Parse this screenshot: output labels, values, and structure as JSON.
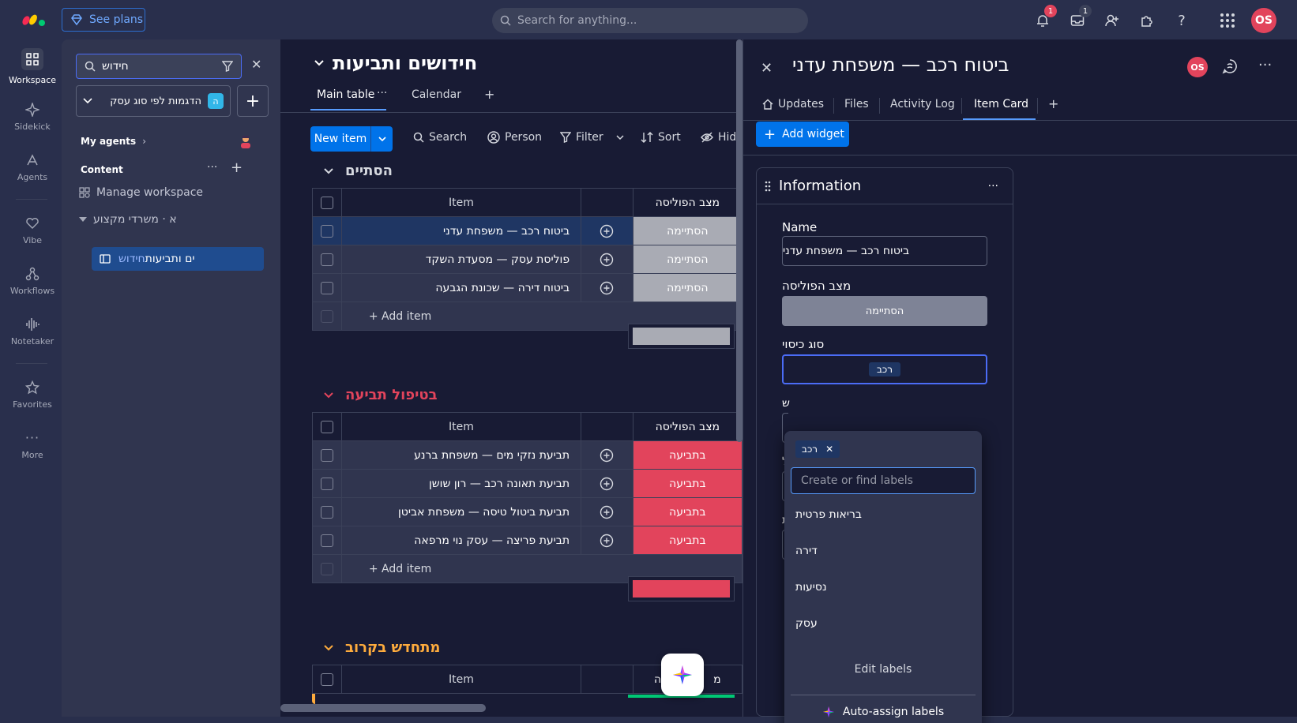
{
  "topbar": {
    "see_plans": "See plans",
    "search_placeholder": "Search for anything...",
    "notifications_count": "1",
    "inbox_count": "1",
    "avatar_initials": "OS"
  },
  "rail": {
    "items": [
      {
        "label": "Workspace",
        "icon": "grid-icon"
      },
      {
        "label": "Sidekick",
        "icon": "sparkle-icon"
      },
      {
        "label": "Agents",
        "icon": "agent-icon"
      },
      {
        "label": "Vibe",
        "icon": "heart-icon"
      },
      {
        "label": "Workflows",
        "icon": "workflow-icon"
      },
      {
        "label": "Notetaker",
        "icon": "waveform-icon"
      },
      {
        "label": "Favorites",
        "icon": "star-icon"
      },
      {
        "label": "More",
        "icon": "more-icon"
      }
    ]
  },
  "workspace": {
    "search_value": "חידוש",
    "workspace_select": "הדגמות לפי סוג עסק",
    "workspace_badge": "ה",
    "my_agents": "My agents",
    "content": "Content",
    "manage": "Manage workspace",
    "folder": "א · משרדי מקצוע",
    "board_highlight": "חידוש",
    "board_rest": "ים ותביעות"
  },
  "board": {
    "title": "חידושים ותביעות",
    "tabs": {
      "main": "Main table",
      "calendar": "Calendar"
    },
    "toolbar": {
      "new_item": "New item",
      "search": "Search",
      "person": "Person",
      "filter": "Filter",
      "sort": "Sort",
      "hide": "Hid"
    },
    "columns": {
      "item": "Item",
      "status": "מצב הפוליסה"
    },
    "add_item": "+ Add item",
    "groups": [
      {
        "title": "הסתיים",
        "color": "#c4c4c4",
        "rows": [
          {
            "item": "ביטוח רכב — משפחת עדני",
            "status": "הסתיימה",
            "status_color": "#a9abb4",
            "selected": true
          },
          {
            "item": "פוליסת עסק — מסעדת השקד",
            "status": "הסתיימה",
            "status_color": "#a9abb4",
            "selected": false
          },
          {
            "item": "ביטוח דירה — שכונת הגבעה",
            "status": "הסתיימה",
            "status_color": "#a9abb4",
            "selected": false
          }
        ]
      },
      {
        "title": "בטיפול תביעה",
        "color": "#e2445c",
        "rows": [
          {
            "item": "תביעת נזקי מים — משפחת ברנע",
            "status": "בתביעה",
            "status_color": "#e2445c",
            "selected": false
          },
          {
            "item": "תביעת תאונה רכב — רון שושן",
            "status": "בתביעה",
            "status_color": "#e2445c",
            "selected": false
          },
          {
            "item": "תביעת ביטול טיסה — משפחת אביטן",
            "status": "בתביעה",
            "status_color": "#e2445c",
            "selected": false
          },
          {
            "item": "תביעת פריצה — עסק נוי מרפאה",
            "status": "בתביעה",
            "status_color": "#e2445c",
            "selected": false
          }
        ]
      },
      {
        "title": "מתחדש בקרוב",
        "color": "#fdab3d",
        "rows": []
      }
    ],
    "third_status_partial": "מ",
    "third_status_partial_tail": "ה"
  },
  "panel": {
    "title": "ביטוח רכב — משפחת עדני",
    "avatar": "OS",
    "tabs": [
      "Updates",
      "Files",
      "Activity Log",
      "Item Card"
    ],
    "add_widget": "Add widget",
    "info_title": "Information",
    "fields": {
      "name_label": "Name",
      "name_value": "ביטוח רכב — משפחת עדני",
      "status_label": "מצב הפוליסה",
      "status_value": "הסתיימה",
      "coverage_label": "סוג כיסוי",
      "coverage_value": "רכב"
    },
    "dropdown": {
      "chip": "רכב",
      "input_placeholder": "Create or find labels",
      "options": [
        "בריאות פרטית",
        "דירה",
        "נסיעות",
        "עסק"
      ],
      "edit_labels": "Edit labels",
      "auto_assign": "Auto-assign labels"
    },
    "covered_letters": [
      "ש",
      "ל",
      "ת"
    ]
  }
}
